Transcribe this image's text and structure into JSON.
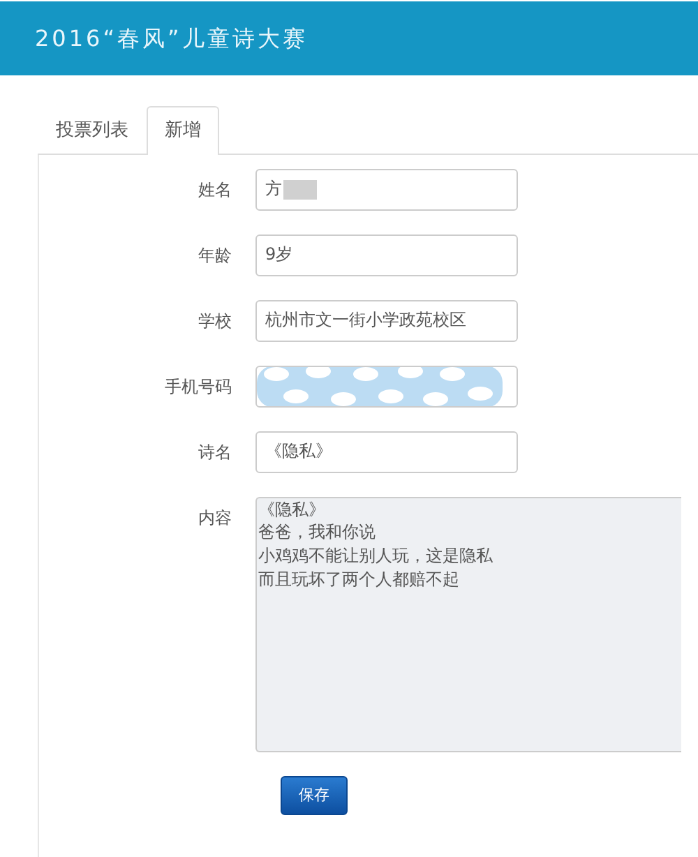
{
  "header": {
    "title": "2016“春风”儿童诗大赛"
  },
  "tabs": [
    {
      "label": "投票列表",
      "selected": false
    },
    {
      "label": "新增",
      "selected": true
    }
  ],
  "form": {
    "fields": [
      {
        "kind": "input",
        "label": "姓名",
        "value": "方",
        "redacted": true
      },
      {
        "kind": "input",
        "label": "年龄",
        "value": "9岁",
        "redacted": false
      },
      {
        "kind": "input",
        "label": "学校",
        "value": "杭州市文一街小学政苑校区",
        "redacted": false
      },
      {
        "kind": "input",
        "label": "手机号码",
        "redacted": true
      },
      {
        "kind": "input",
        "label": "诗名",
        "value": "《隐私》",
        "redacted": false
      },
      {
        "kind": "textarea",
        "label": "内容",
        "lines": [
          "《隐私》",
          "爸爸，我和你说",
          "小鸡鸡不能让别人玩，这是隐私",
          "而且玩坏了两个人都赔不起"
        ],
        "disabled": true
      }
    ],
    "submit": {
      "label": "保存"
    }
  }
}
